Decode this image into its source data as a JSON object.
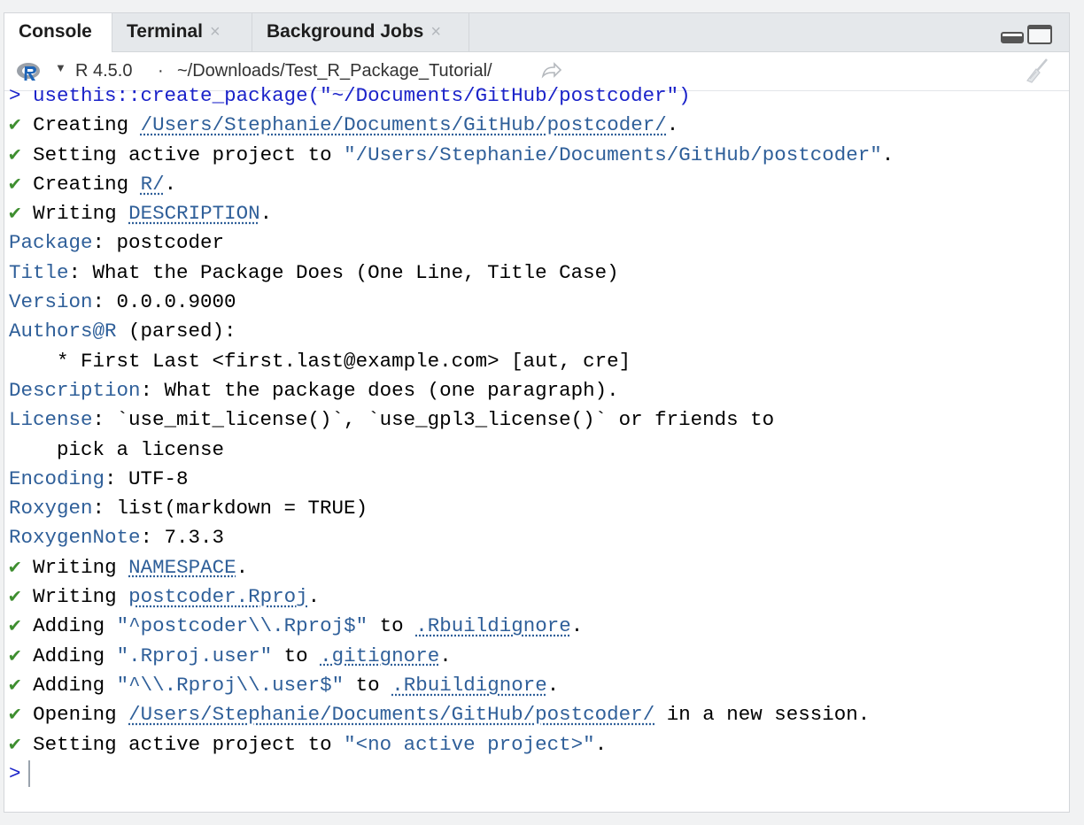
{
  "tabs": [
    {
      "label": "Console"
    },
    {
      "label": "Terminal",
      "close": "×"
    },
    {
      "label": "Background Jobs",
      "close": "×"
    }
  ],
  "toolbar": {
    "r_version": "R 4.5.0",
    "separator": "·",
    "path": "~/Downloads/Test_R_Package_Tutorial/"
  },
  "console": {
    "prompt": ">",
    "check": "✔",
    "command": "usethis::create_package(\"~/Documents/GitHub/postcoder\")",
    "l1_text": "Creating",
    "l1_link": "/Users/Stephanie/Documents/GitHub/postcoder/",
    "l1_end": ".",
    "l2_text": "Setting active project to",
    "l2_str": "\"/Users/Stephanie/Documents/GitHub/postcoder\"",
    "l2_end": ".",
    "l3_text": "Creating",
    "l3_link": "R/",
    "l3_end": ".",
    "l4_text": "Writing",
    "l4_link": "DESCRIPTION",
    "l4_end": ".",
    "desc": [
      {
        "key": "Package",
        "value": ": postcoder"
      },
      {
        "key": "Title",
        "value": ": What the Package Does (One Line, Title Case)"
      },
      {
        "key": "Version",
        "value": ": 0.0.0.9000"
      },
      {
        "key": "Authors@R",
        "value": " (parsed):"
      },
      {
        "key": "",
        "value": "    * First Last <first.last@example.com> [aut, cre]"
      },
      {
        "key": "Description",
        "value": ": What the package does (one paragraph)."
      },
      {
        "key": "License",
        "value": ": `use_mit_license()`, `use_gpl3_license()` or friends to"
      },
      {
        "key": "",
        "value": "    pick a license"
      },
      {
        "key": "Encoding",
        "value": ": UTF-8"
      },
      {
        "key": "Roxygen",
        "value": ": list(markdown = TRUE)"
      },
      {
        "key": "RoxygenNote",
        "value": ": 7.3.3"
      }
    ],
    "l5_text": "Writing",
    "l5_link": "NAMESPACE",
    "l5_end": ".",
    "l6_text": "Writing",
    "l6_link": "postcoder.Rproj",
    "l6_end": ".",
    "l7_text": "Adding",
    "l7_str": "\"^postcoder\\\\.Rproj$\"",
    "l7_mid": "to",
    "l7_link": ".Rbuildignore",
    "l7_end": ".",
    "l8_text": "Adding",
    "l8_str": "\".Rproj.user\"",
    "l8_mid": "to",
    "l8_link": ".gitignore",
    "l8_end": ".",
    "l9_text": "Adding",
    "l9_str": "\"^\\\\.Rproj\\\\.user$\"",
    "l9_mid": "to",
    "l9_link": ".Rbuildignore",
    "l9_end": ".",
    "l10_text": "Opening",
    "l10_link": "/Users/Stephanie/Documents/GitHub/postcoder/",
    "l10_end": " in a new session.",
    "l11_text": "Setting active project to",
    "l11_str": "\"<no active project>\"",
    "l11_end": "."
  },
  "colors": {
    "command": "#1a22c9",
    "key": "#2f5f99",
    "check": "#3e8e2f",
    "tab_bg": "#e5e8eb"
  },
  "icons": {
    "r_logo": "r-logo-icon",
    "goto": "arrow-goto-icon",
    "clear": "broom-icon",
    "minimize": "minimize-icon",
    "maximize": "maximize-icon"
  }
}
